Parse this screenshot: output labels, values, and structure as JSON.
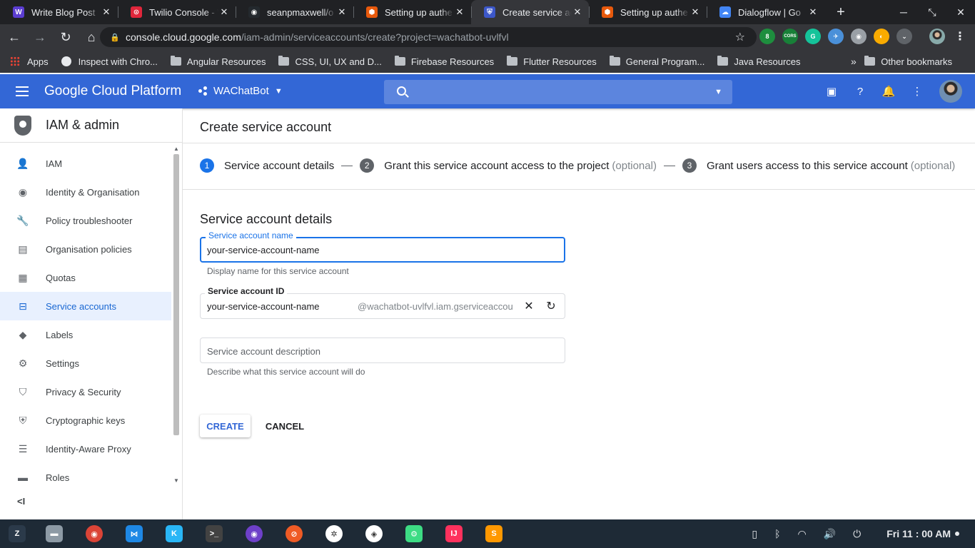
{
  "browser": {
    "tabs": [
      {
        "title": "Write Blog Post",
        "fav_color": "#5b3dd1",
        "fav_glyph": "W",
        "active": false
      },
      {
        "title": "Twilio Console - W",
        "fav_color": "#e0263b",
        "fav_glyph": "⊙",
        "active": false
      },
      {
        "title": "seanpmaxwell/o",
        "fav_color": "#24292e",
        "fav_glyph": "◉",
        "active": false
      },
      {
        "title": "Setting up authe",
        "fav_color": "#e8590c",
        "fav_glyph": "⬢",
        "active": false
      },
      {
        "title": "Create service ac",
        "fav_color": "#3c57c9",
        "fav_glyph": "⛨",
        "active": true
      },
      {
        "title": "Setting up authe",
        "fav_color": "#e8590c",
        "fav_glyph": "⬢",
        "active": false
      },
      {
        "title": "Dialogflow | Go",
        "fav_color": "#4285f4",
        "fav_glyph": "☁",
        "active": false
      }
    ],
    "close_glyph": "✕",
    "new_tab_glyph": "+",
    "address": {
      "host": "console.cloud.google.com",
      "path": "/iam-admin/serviceaccounts/create?project=wachatbot-uvlfvl"
    },
    "extensions": [
      {
        "name": "shield-ext-icon",
        "color": "#1e8e3e",
        "glyph": "8"
      },
      {
        "name": "cors-ext-icon",
        "color": "#188038",
        "glyph": "CORS"
      },
      {
        "name": "grammarly-icon",
        "color": "#15c39a",
        "glyph": "G"
      },
      {
        "name": "plane-ext-icon",
        "color": "#4a90d9",
        "glyph": "✈"
      },
      {
        "name": "circle-ext-icon",
        "color": "#9aa0a6",
        "glyph": "◉"
      },
      {
        "name": "moon-ext-icon",
        "color": "#f9ab00",
        "glyph": "◐"
      },
      {
        "name": "pocket-icon",
        "color": "#5f6368",
        "glyph": "⌄"
      }
    ],
    "bookmarks": [
      {
        "label": "Apps",
        "type": "apps"
      },
      {
        "label": "Inspect with Chro...",
        "type": "globe"
      },
      {
        "label": "Angular Resources",
        "type": "folder"
      },
      {
        "label": "CSS, UI, UX and D...",
        "type": "folder"
      },
      {
        "label": "Firebase Resources",
        "type": "folder"
      },
      {
        "label": "Flutter Resources",
        "type": "folder"
      },
      {
        "label": "General Program...",
        "type": "folder"
      },
      {
        "label": "Java Resources",
        "type": "folder"
      }
    ],
    "bookmarks_overflow": "»",
    "other_bookmarks": "Other bookmarks"
  },
  "gcp": {
    "title": "Google Cloud Platform",
    "project": "WAChatBot",
    "search_placeholder": ""
  },
  "sidebar": {
    "header": "IAM & admin",
    "items": [
      {
        "label": "IAM",
        "icon": "person-add-icon",
        "glyph": "👤",
        "active": false
      },
      {
        "label": "Identity & Organisation",
        "icon": "account-circle-icon",
        "glyph": "◉",
        "active": false
      },
      {
        "label": "Policy troubleshooter",
        "icon": "wrench-icon",
        "glyph": "🔧",
        "active": false
      },
      {
        "label": "Organisation policies",
        "icon": "list-box-icon",
        "glyph": "▤",
        "active": false
      },
      {
        "label": "Quotas",
        "icon": "quota-grid-icon",
        "glyph": "▦",
        "active": false
      },
      {
        "label": "Service accounts",
        "icon": "service-account-icon",
        "glyph": "⊟",
        "active": true
      },
      {
        "label": "Labels",
        "icon": "label-tag-icon",
        "glyph": "◆",
        "active": false
      },
      {
        "label": "Settings",
        "icon": "settings-gear-icon",
        "glyph": "⚙",
        "active": false
      },
      {
        "label": "Privacy & Security",
        "icon": "privacy-shield-icon",
        "glyph": "⛉",
        "active": false
      },
      {
        "label": "Cryptographic keys",
        "icon": "key-shield-icon",
        "glyph": "⛨",
        "active": false
      },
      {
        "label": "Identity-Aware Proxy",
        "icon": "proxy-list-icon",
        "glyph": "☰",
        "active": false
      },
      {
        "label": "Roles",
        "icon": "roles-hat-icon",
        "glyph": "▬",
        "active": false
      }
    ],
    "collapse_glyph": "<I"
  },
  "main": {
    "title": "Create service account",
    "steps": [
      {
        "num": "1",
        "label": "Service account details",
        "optional": ""
      },
      {
        "num": "2",
        "label": "Grant this service account access to the project",
        "optional": "(optional)"
      },
      {
        "num": "3",
        "label": "Grant users access to this service account",
        "optional": "(optional)"
      }
    ],
    "section_title": "Service account details",
    "name_field": {
      "label": "Service account name",
      "value": "your-service-account-name",
      "hint": "Display name for this service account"
    },
    "id_field": {
      "label": "Service account ID",
      "value": "your-service-account-name",
      "suffix": "@wachatbot-uvlfvl.iam.gserviceaccou"
    },
    "desc_field": {
      "placeholder": "Service account description",
      "hint": "Describe what this service account will do"
    },
    "create_label": "CREATE",
    "cancel_label": "CANCEL"
  },
  "taskbar": {
    "apps": [
      {
        "name": "zorin-menu-icon",
        "color": "#2b3a4a",
        "glyph": "Z"
      },
      {
        "name": "files-icon",
        "color": "#8d9aa5",
        "glyph": "▬"
      },
      {
        "name": "chrome-icon",
        "color": "#db4437",
        "glyph": "◉"
      },
      {
        "name": "vscode-icon",
        "color": "#1e88e5",
        "glyph": "⋈"
      },
      {
        "name": "kotlin-icon",
        "color": "#29b6f6",
        "glyph": "K"
      },
      {
        "name": "terminal-icon",
        "color": "#424242",
        "glyph": ">_"
      },
      {
        "name": "github-desktop-icon",
        "color": "#6e40c9",
        "glyph": "◉"
      },
      {
        "name": "postman-icon",
        "color": "#ef5b25",
        "glyph": "⊘"
      },
      {
        "name": "slack-icon",
        "color": "#ffffff",
        "glyph": "✲"
      },
      {
        "name": "mongodb-icon",
        "color": "#ffffff",
        "glyph": "◈"
      },
      {
        "name": "android-studio-icon",
        "color": "#3ddc84",
        "glyph": "⚙"
      },
      {
        "name": "intellij-icon",
        "color": "#fe315d",
        "glyph": "IJ"
      },
      {
        "name": "sublime-icon",
        "color": "#ff9800",
        "glyph": "S"
      }
    ],
    "clock": "Fri 11 : 00 AM"
  },
  "colors": {
    "gcp_blue": "#3367d6",
    "accent": "#1a73e8",
    "active_nav_bg": "#e8f0fe"
  }
}
